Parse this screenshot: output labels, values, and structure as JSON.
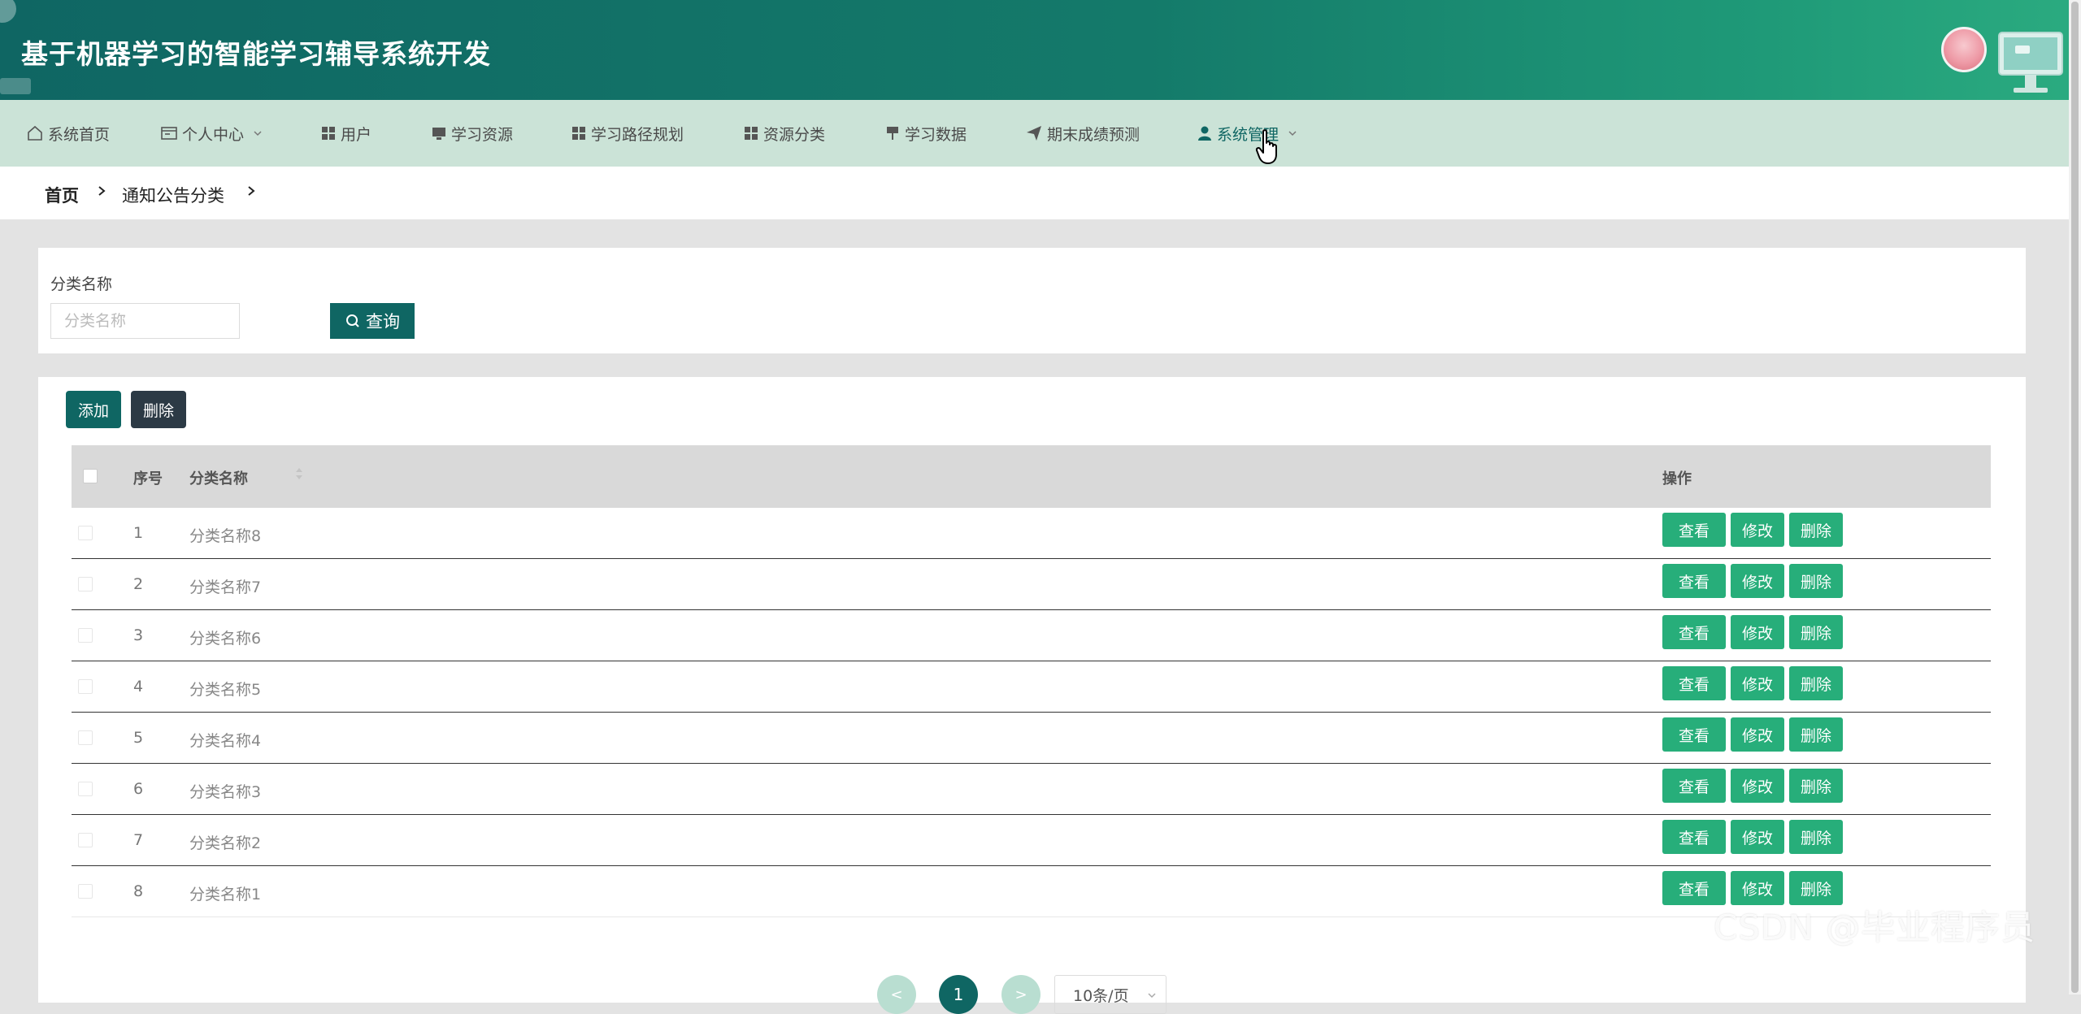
{
  "header": {
    "title": "基于机器学习的智能学习辅导系统开发"
  },
  "nav": {
    "items": [
      {
        "label": "系统首页",
        "icon": "home-icon"
      },
      {
        "label": "个人中心",
        "icon": "profile-card-icon",
        "has_dropdown": true
      },
      {
        "label": "用户",
        "icon": "grid-icon"
      },
      {
        "label": "学习资源",
        "icon": "monitor-icon"
      },
      {
        "label": "学习路径规划",
        "icon": "grid-icon"
      },
      {
        "label": "资源分类",
        "icon": "grid-icon"
      },
      {
        "label": "学习数据",
        "icon": "pin-icon"
      },
      {
        "label": "期末成绩预测",
        "icon": "paper-plane-icon"
      },
      {
        "label": "系统管理",
        "icon": "user-icon",
        "has_dropdown": true,
        "active": true
      }
    ]
  },
  "breadcrumb": {
    "home": "首页",
    "current": "通知公告分类"
  },
  "search": {
    "label": "分类名称",
    "placeholder": "分类名称",
    "query_label": "查询"
  },
  "toolbar": {
    "add_label": "添加",
    "delete_label": "删除"
  },
  "table": {
    "columns": {
      "index": "序号",
      "name": "分类名称",
      "actions": "操作"
    },
    "rows": [
      {
        "index": "1",
        "name": "分类名称8"
      },
      {
        "index": "2",
        "name": "分类名称7"
      },
      {
        "index": "3",
        "name": "分类名称6"
      },
      {
        "index": "4",
        "name": "分类名称5"
      },
      {
        "index": "5",
        "name": "分类名称4"
      },
      {
        "index": "6",
        "name": "分类名称3"
      },
      {
        "index": "7",
        "name": "分类名称2"
      },
      {
        "index": "8",
        "name": "分类名称1"
      }
    ],
    "row_actions": {
      "view": "查看",
      "edit": "修改",
      "delete": "删除"
    }
  },
  "pagination": {
    "prev": "<",
    "current_page": "1",
    "next": ">",
    "page_size": "10条/页"
  },
  "watermark": "CSDN @毕业程序员",
  "colors": {
    "primary": "#0f6663",
    "action_green": "#27ae7a",
    "nav_bg": "#cbe3d7",
    "dark_button": "#2c3a45"
  }
}
